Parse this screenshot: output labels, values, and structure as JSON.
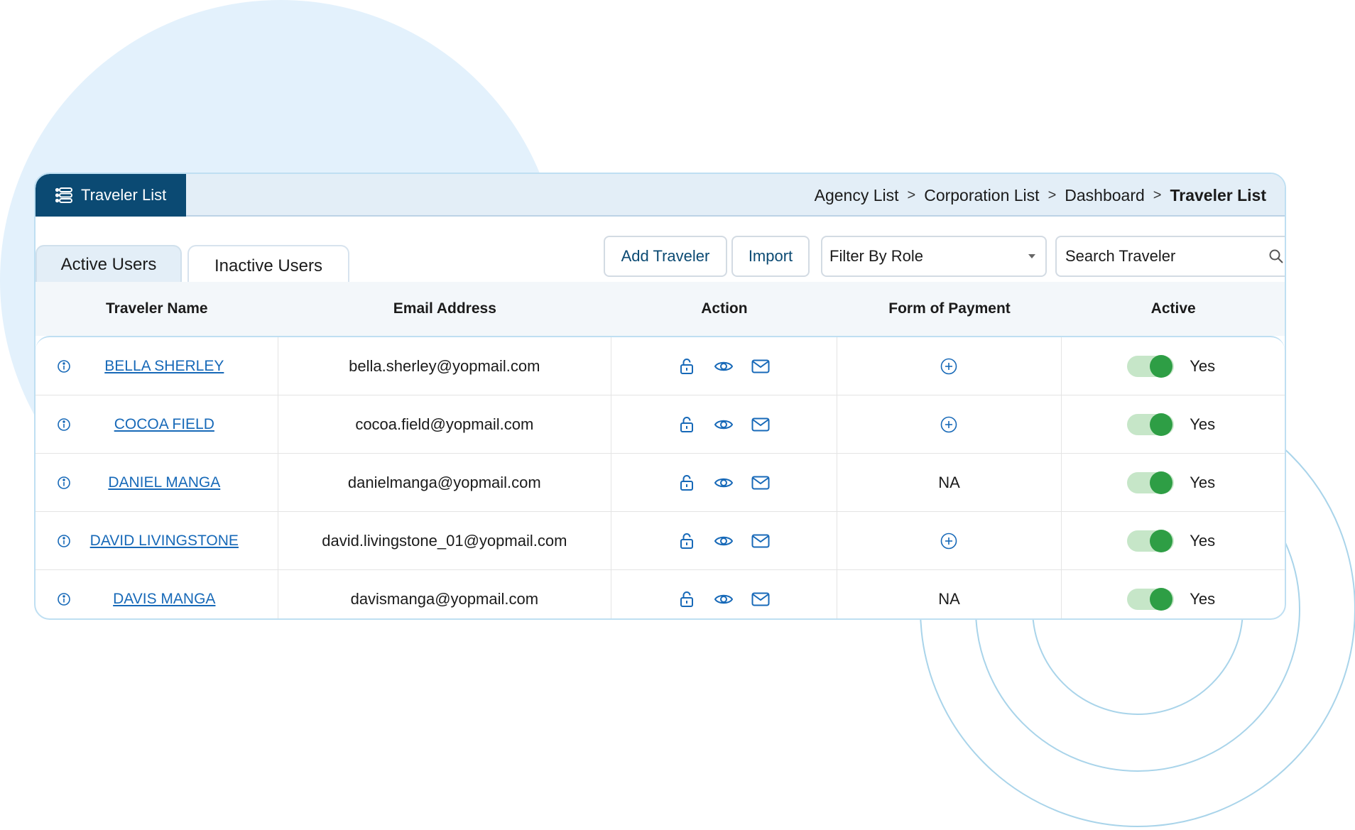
{
  "header": {
    "title": "Traveler List",
    "breadcrumb": [
      "Agency List",
      "Corporation List",
      "Dashboard"
    ],
    "breadcrumb_current": "Traveler List"
  },
  "tabs": {
    "active": "Active Users",
    "inactive": "Inactive Users"
  },
  "toolbar": {
    "add_label": "Add Traveler",
    "import_label": "Import",
    "filter_label": "Filter By Role",
    "search_placeholder": "Search Traveler"
  },
  "table": {
    "columns": [
      "Traveler Name",
      "Email Address",
      "Action",
      "Form of Payment",
      "Active"
    ],
    "rows": [
      {
        "name": "BELLA SHERLEY",
        "email": "bella.sherley@yopmail.com",
        "payment": "",
        "active": "Yes"
      },
      {
        "name": "COCOA FIELD",
        "email": "cocoa.field@yopmail.com",
        "payment": "",
        "active": "Yes"
      },
      {
        "name": "DANIEL MANGA",
        "email": "danielmanga@yopmail.com",
        "payment": "NA",
        "active": "Yes"
      },
      {
        "name": "DAVID LIVINGSTONE",
        "email": "david.livingstone_01@yopmail.com",
        "payment": "",
        "active": "Yes"
      },
      {
        "name": "DAVIS MANGA",
        "email": "davismanga@yopmail.com",
        "payment": "NA",
        "active": "Yes"
      }
    ]
  },
  "colors": {
    "primary": "#0b4a73",
    "link": "#1769b8",
    "toggle_on": "#2e9e45",
    "toggle_track": "#c6e6c8",
    "header_bg": "#e3eef7"
  },
  "icons": {
    "title": "list-icon",
    "search": "search-icon",
    "info": "info-icon",
    "lock": "lock-icon",
    "view": "eye-icon",
    "mail": "mail-icon",
    "add_payment": "plus-circle-icon"
  }
}
